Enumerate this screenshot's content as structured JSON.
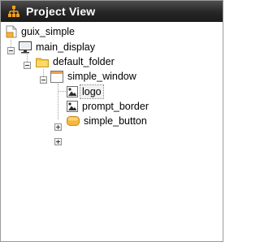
{
  "panel": {
    "title": "Project View"
  },
  "tree": {
    "project": {
      "label": "guix_simple",
      "icon": "project-icon"
    },
    "display": {
      "label": "main_display",
      "icon": "monitor-icon",
      "expanded": true
    },
    "folder": {
      "label": "default_folder",
      "icon": "folder-icon",
      "expanded": true
    },
    "window": {
      "label": "simple_window",
      "icon": "window-icon",
      "expanded": true
    },
    "children": [
      {
        "label": "logo",
        "icon": "image-icon",
        "expandable": false,
        "selected": true
      },
      {
        "label": "prompt_border",
        "icon": "image-icon",
        "expandable": true,
        "selected": false
      },
      {
        "label": "simple_button",
        "icon": "button-icon",
        "expandable": true,
        "selected": false
      }
    ]
  },
  "colors": {
    "header_bg": "#262626",
    "folder_yellow": "#f5c542",
    "button_orange": "#f6b73c",
    "selection_outline": "#808080"
  }
}
